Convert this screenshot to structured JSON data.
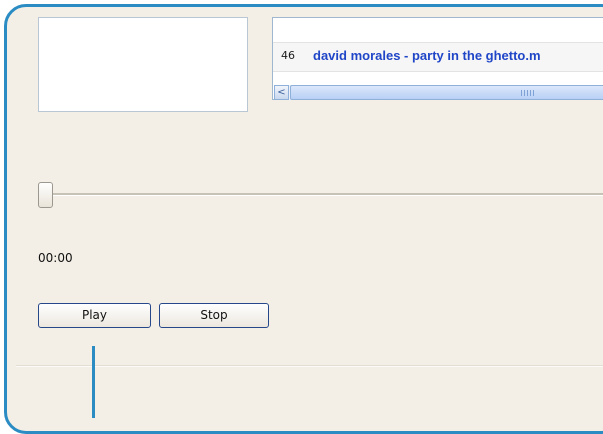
{
  "playlist": {
    "rows": [
      {
        "number": "46",
        "title": "david morales - party in the ghetto.m"
      }
    ],
    "scroll_left_glyph": "<"
  },
  "player": {
    "position": 0.0,
    "time": "00:00",
    "play_label": "Play",
    "stop_label": "Stop"
  },
  "colors": {
    "frame": "#2b8cc4",
    "panel_bg": "#f3efe6",
    "link_text": "#2046c8"
  }
}
